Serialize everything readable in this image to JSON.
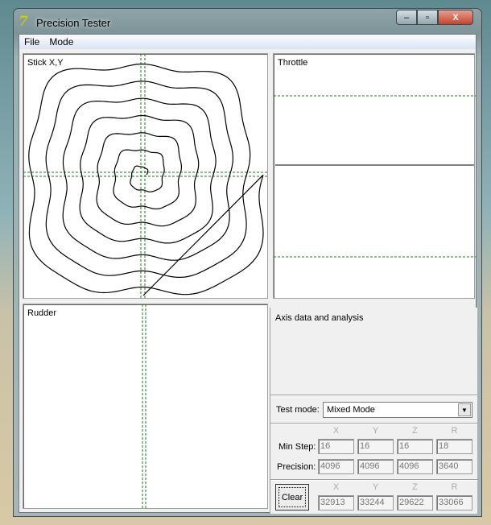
{
  "window": {
    "title": "Precision Tester",
    "minimize": "–",
    "maximize": "▫",
    "close": "X"
  },
  "menu": [
    "File",
    "Mode"
  ],
  "panels": {
    "stick": "Stick X,Y",
    "throttle": "Throttle",
    "rudder": "Rudder",
    "analysis": "Axis data and analysis"
  },
  "test_mode": {
    "label": "Test mode:",
    "value": "Mixed Mode"
  },
  "axes": [
    "X",
    "Y",
    "Z",
    "R"
  ],
  "min_step": {
    "label": "Min Step:",
    "values": [
      "16",
      "16",
      "16",
      "18"
    ]
  },
  "precision": {
    "label": "Precision:",
    "values": [
      "4096",
      "4096",
      "4096",
      "3640"
    ]
  },
  "clear_label": "Clear",
  "current": {
    "values": [
      "32913",
      "33244",
      "29622",
      "33066"
    ]
  },
  "colors": {
    "guide": "#1a7a1a",
    "trace": "#000000"
  }
}
